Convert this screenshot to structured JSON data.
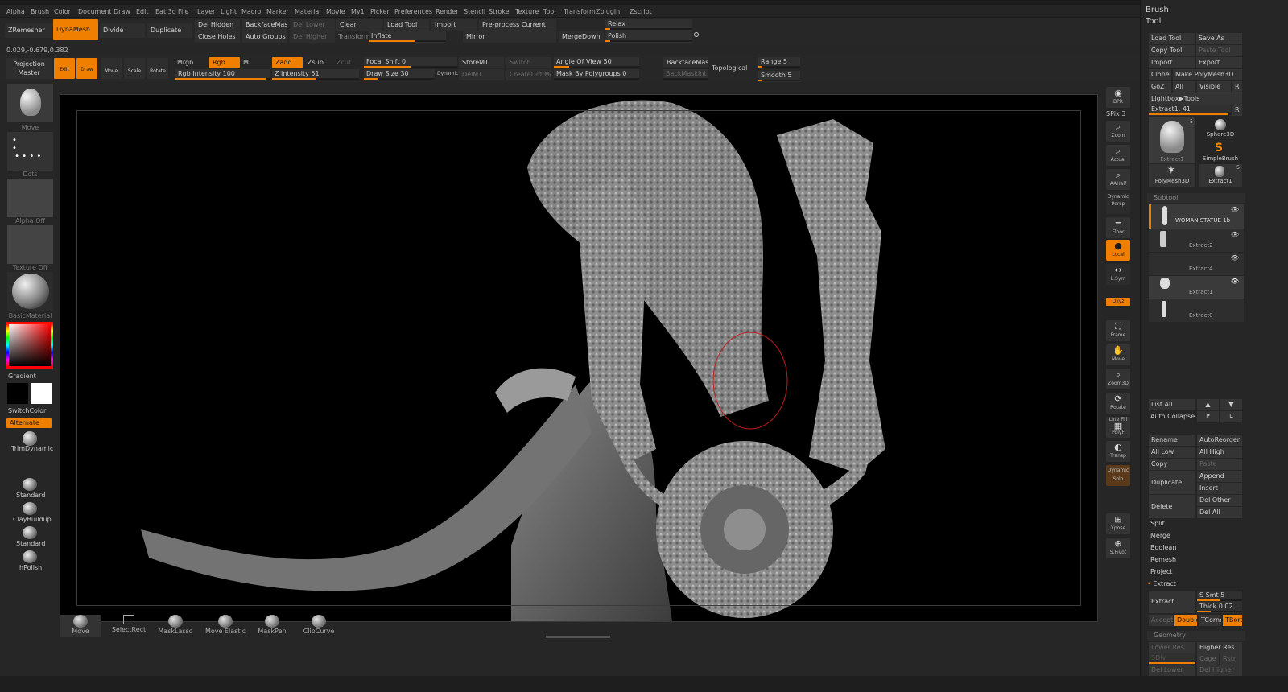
{
  "menu": [
    "Alpha",
    "Brush",
    "Color",
    "Document",
    "Draw",
    "Edit",
    "Eat 3d",
    "File",
    "Layer",
    "Light",
    "Macro",
    "Marker",
    "Material",
    "Movie",
    "My1",
    "Picker",
    "Preferences",
    "Render",
    "Stencil",
    "Stroke",
    "Texture",
    "Tool",
    "Transform",
    "Zplugin",
    "Zscript"
  ],
  "coords": "0.029,-0.679,0.382",
  "shelf1": {
    "zremesher": "ZRemesher",
    "dynamesh": "DynaMesh",
    "divide": "Divide",
    "duplicate": "Duplicate",
    "del_hidden": "Del Hidden",
    "close_holes": "Close Holes",
    "backface_mask": "BackfaceMask",
    "auto_groups": "Auto Groups",
    "del_lower": "Del Lower",
    "del_higher": "Del Higher",
    "clear": "Clear",
    "transform": "Transform",
    "load_tool": "Load Tool",
    "inflate": "Inflate",
    "import": "Import",
    "pre_process": "Pre-process Current",
    "mirror": "Mirror",
    "merge_down": "MergeDown",
    "relax": "Relax",
    "polish": "Polish"
  },
  "shelf2": {
    "projection_master": "Projection Master",
    "edit": "Edit",
    "draw": "Draw",
    "move": "Move",
    "scale": "Scale",
    "rotate": "Rotate",
    "mrgb": "Mrgb",
    "rgb": "Rgb",
    "m": "M",
    "rgb_intensity": "Rgb Intensity 100",
    "zadd": "Zadd",
    "zsub": "Zsub",
    "zcut": "Zcut",
    "z_intensity": "Z Intensity 51",
    "focal_shift": "Focal Shift 0",
    "draw_size": "Draw Size 30",
    "dynamic": "Dynamic",
    "store_mt": "StoreMT",
    "del_mt": "DelMT",
    "switch": "Switch",
    "create_diff": "CreateDiff Mesh",
    "angle_of_view": "Angle Of View 50",
    "mask_by_polygroups": "Mask By Polygroups 0",
    "backface_mask": "BackfaceMask",
    "backface_mask_int": "BackMaskInt",
    "topological": "Topological",
    "range": "Range 5",
    "smooth": "Smooth 5",
    "rgb_fill": 0.96,
    "z_fill": 0.51,
    "focal_fill": 0.5,
    "drawsize_fill": 0.2,
    "angle_fill": 0.35
  },
  "left": {
    "move": "Move",
    "dots": "Dots",
    "alpha_off": "Alpha Off",
    "texture_off": "Texture Off",
    "basic_material": "BasicMaterial",
    "gradient": "Gradient",
    "switch_color": "SwitchColor",
    "alternate": "Alternate",
    "trim_dynamic": "TrimDynamic",
    "brushes": [
      "Standard",
      "ClayBuildup",
      "Standard",
      "hPolish"
    ],
    "main_color": "#ffffff",
    "secondary_color": "#000000"
  },
  "righttool": {
    "bpr": "BPR",
    "spix": "SPix 3",
    "zoom": "Zoom",
    "actual": "Actual",
    "aahalf": "AAHalf",
    "dynamic": "Dynamic",
    "persp": "Persp",
    "floor": "Floor",
    "local": "Local",
    "lsym": "L.Sym",
    "xyz": "Qxyz",
    "frame": "Frame",
    "move": "Move",
    "zoom3d": "Zoom3D",
    "rotate": "Rotate",
    "line_fill": "Line Fill",
    "polyf": "PolyF",
    "transp": "Transp",
    "dynamic2": "Dynamic",
    "solo": "Solo",
    "xpose": "Xpose",
    "spivot": "S.Pivot"
  },
  "tray": {
    "brush": "Brush",
    "tool": "Tool",
    "load_tool": "Load Tool",
    "save_as": "Save As",
    "copy_tool": "Copy Tool",
    "paste_tool": "Paste Tool",
    "import": "Import",
    "export": "Export",
    "clone": "Clone",
    "make_polymesh": "Make PolyMesh3D",
    "goz": "GoZ",
    "all": "All",
    "visible": "Visible",
    "r": "R",
    "lightbox_tools": "Lightbox▶Tools",
    "current_tool": "Extract1. 41",
    "r2": "R",
    "tool_thumbs": [
      {
        "label": "Extract1",
        "count": "5"
      },
      {
        "label": "Sphere3D",
        "count": ""
      },
      {
        "label": "SimpleBrush",
        "count": ""
      },
      {
        "label": "PolyMesh3D",
        "count": ""
      },
      {
        "label": "Extract1",
        "count": "5"
      }
    ],
    "subtool_header": "Subtool",
    "subtools": [
      "WOMAN STATUE 1b",
      "Extract2",
      "Extract4",
      "Extract1",
      "Extract0"
    ],
    "list_all": "List All",
    "auto_collapse": "Auto Collapse",
    "rename": "Rename",
    "auto_reorder": "AutoReorder",
    "all_low": "All Low",
    "all_high": "All High",
    "copy": "Copy",
    "paste": "Paste",
    "append": "Append",
    "duplicate": "Duplicate",
    "insert": "Insert",
    "del_other": "Del Other",
    "delete": "Delete",
    "del_all": "Del All",
    "split": "Split",
    "merge": "Merge",
    "boolean": "Boolean",
    "remesh": "Remesh",
    "project": "Project",
    "extract_header": "Extract",
    "extract": "Extract",
    "s_smt": "S Smt 5",
    "thick": "Thick 0.02",
    "accept": "Accept",
    "double": "Double",
    "tcorne": "TCorne",
    "tborde": "TBorde",
    "geometry_header": "Geometry",
    "lower_res": "Lower Res",
    "higher_res": "Higher Res",
    "sdiv": "SDiv",
    "cage": "Cage",
    "rstr": "Rstr",
    "del_lower": "Del Lower",
    "del_higher": "Del Higher"
  },
  "bottom": [
    "Move",
    "SelectRect",
    "MaskLasso",
    "Move Elastic",
    "MaskPen",
    "ClipCurve"
  ]
}
